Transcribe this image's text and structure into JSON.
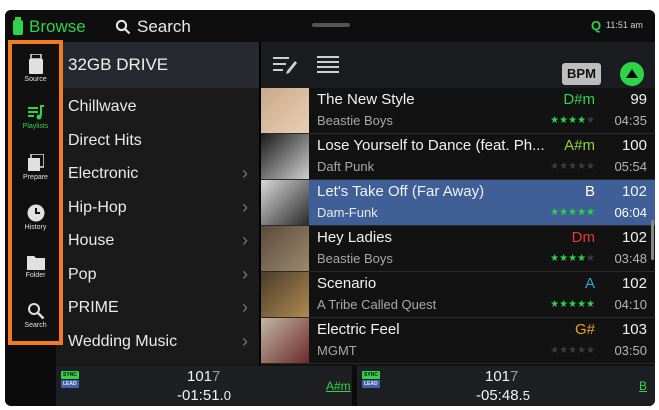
{
  "topbar": {
    "browse_label": "Browse",
    "search_label": "Search",
    "q_label": "Q",
    "time": "11:51 am"
  },
  "sidebar": {
    "items": [
      {
        "label": "Source",
        "icon": "usb-icon"
      },
      {
        "label": "Playlists",
        "icon": "playlist-icon",
        "active": true
      },
      {
        "label": "Prepare",
        "icon": "prepare-icon"
      },
      {
        "label": "History",
        "icon": "clock-icon"
      },
      {
        "label": "Folder",
        "icon": "folder-icon"
      },
      {
        "label": "Search",
        "icon": "search-icon"
      }
    ],
    "highlight_color": "#f07c22"
  },
  "drive": {
    "title": "32GB DRIVE"
  },
  "crates": [
    {
      "name": "Chillwave",
      "has_children": false
    },
    {
      "name": "Direct Hits",
      "has_children": false
    },
    {
      "name": "Electronic",
      "has_children": true
    },
    {
      "name": "Hip-Hop",
      "has_children": true
    },
    {
      "name": "House",
      "has_children": true
    },
    {
      "name": "Pop",
      "has_children": true
    },
    {
      "name": "PRIME",
      "has_children": true
    },
    {
      "name": "Wedding Music",
      "has_children": true
    }
  ],
  "toolbar": {
    "bpm_label": "BPM"
  },
  "tracks": [
    {
      "title": "The New Style",
      "artist": "Beastie Boys",
      "key": "D#m",
      "key_color": "#2fd34a",
      "rating": 4,
      "bpm": "99",
      "length": "04:35"
    },
    {
      "title": "Lose Yourself to Dance (feat. Ph...",
      "artist": "Daft Punk",
      "key": "A#m",
      "key_color": "#8bd63a",
      "rating": 0,
      "bpm": "100",
      "length": "05:54"
    },
    {
      "title": "Let's Take Off (Far Away)",
      "artist": "Dam-Funk",
      "key": "B",
      "key_color": "#ffffff",
      "rating": 5,
      "bpm": "102",
      "length": "06:04",
      "selected": true
    },
    {
      "title": "Hey Ladies",
      "artist": "Beastie Boys",
      "key": "Dm",
      "key_color": "#e33b3b",
      "rating": 4,
      "bpm": "102",
      "length": "03:48"
    },
    {
      "title": "Scenario",
      "artist": "A Tribe Called Quest",
      "key": "A",
      "key_color": "#2fa7c8",
      "rating": 5,
      "bpm": "102",
      "length": "04:10"
    },
    {
      "title": "Electric Feel",
      "artist": "MGMT",
      "key": "G#",
      "key_color": "#e8a21e",
      "rating": 0,
      "bpm": "103",
      "length": "03:50"
    }
  ],
  "decks": [
    {
      "sync": "SYNC",
      "lead": "LEAD",
      "bpm_main": "101",
      "bpm_dim": "7",
      "time_main": "-01:51.",
      "time_dim": "0",
      "key": "A#m"
    },
    {
      "sync": "SYNC",
      "lead": "LEAD",
      "bpm_main": "101",
      "bpm_dim": "7",
      "time_main": "-05:48.",
      "time_dim": "5",
      "key": "B"
    }
  ]
}
